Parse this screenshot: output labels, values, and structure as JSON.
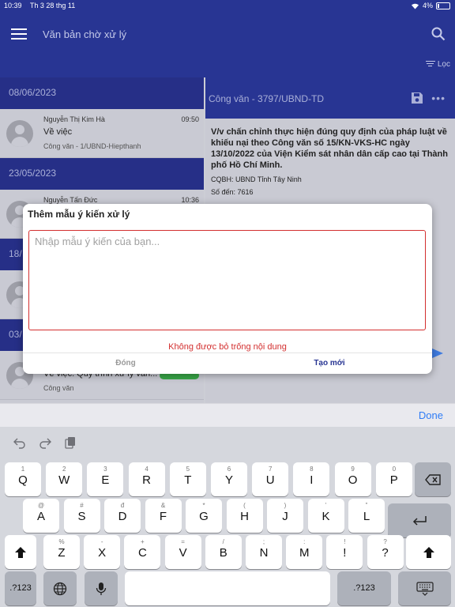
{
  "status_bar": {
    "time": "10:39",
    "date": "Th 3 28 thg 11",
    "battery": "4%"
  },
  "app_bar": {
    "title": "Văn bản chờ xử lý",
    "filter_label": "Lọc"
  },
  "list": {
    "groups": [
      {
        "date": "08/06/2023",
        "sender": "Nguyễn Thị Kim  Hà",
        "time": "09:50",
        "subject": "Về việc",
        "meta": "Công văn - 1/UBND-Hiepthanh"
      },
      {
        "date": "23/05/2023",
        "sender": "Nguyễn Tấn  Đức",
        "time": "10:36",
        "subject": "",
        "meta": ""
      },
      {
        "date": "18/",
        "sender": "",
        "time": "",
        "subject": "",
        "meta": ""
      },
      {
        "date": "03/",
        "sender": "",
        "time": "",
        "subject": "Về việc. Quy trình xử lý  văn...",
        "meta": "Công văn"
      }
    ]
  },
  "detail": {
    "title": "Công văn - 3797/UBND-TD",
    "summary": "V/v chấn chỉnh thực hiện đúng quy định của pháp luật về khiếu nại theo Công văn số 15/KN-VKS-HC ngày 13/10/2022 của Viện Kiểm sát nhân dân cấp cao tại Thành phố Hồ Chí Minh.",
    "cqbh": "CQBH: UBND Tỉnh Tây Ninh",
    "so_den": "Số đến: 7616"
  },
  "dialog": {
    "title": "Thêm mẫu ý kiến xử lý",
    "placeholder": "Nhập mẫu ý kiến của bạn...",
    "error": "Không được bỏ trống nội dung",
    "close_label": "Đóng",
    "create_label": "Tạo mới"
  },
  "keyboard": {
    "done_label": "Done",
    "row1": [
      {
        "sub": "1",
        "main": "Q"
      },
      {
        "sub": "2",
        "main": "W"
      },
      {
        "sub": "3",
        "main": "E"
      },
      {
        "sub": "4",
        "main": "R"
      },
      {
        "sub": "5",
        "main": "T"
      },
      {
        "sub": "6",
        "main": "Y"
      },
      {
        "sub": "7",
        "main": "U"
      },
      {
        "sub": "8",
        "main": "I"
      },
      {
        "sub": "9",
        "main": "O"
      },
      {
        "sub": "0",
        "main": "P"
      }
    ],
    "row2": [
      {
        "sub": "@",
        "main": "A"
      },
      {
        "sub": "#",
        "main": "S"
      },
      {
        "sub": "đ",
        "main": "D"
      },
      {
        "sub": "&",
        "main": "F"
      },
      {
        "sub": "*",
        "main": "G"
      },
      {
        "sub": "(",
        "main": "H"
      },
      {
        "sub": ")",
        "main": "J"
      },
      {
        "sub": "’",
        "main": "K"
      },
      {
        "sub": "”",
        "main": "L"
      }
    ],
    "row3": [
      {
        "sub": "%",
        "main": "Z"
      },
      {
        "sub": "-",
        "main": "X"
      },
      {
        "sub": "+",
        "main": "C"
      },
      {
        "sub": "=",
        "main": "V"
      },
      {
        "sub": "/",
        "main": "B"
      },
      {
        "sub": ";",
        "main": "N"
      },
      {
        "sub": ":",
        "main": "M"
      },
      {
        "sub": "!",
        "main": "!"
      },
      {
        "sub": "?",
        "main": "?"
      }
    ],
    "numbers_label": ".?123"
  },
  "colors": {
    "primary": "#283593",
    "error": "#d32f2f",
    "link": "#2f7cf6"
  },
  "icons": [
    "menu-icon",
    "search-icon",
    "filter-icon",
    "save-icon",
    "more-icon",
    "send-icon",
    "undo-icon",
    "redo-icon",
    "clipboard-icon",
    "backspace-icon",
    "return-icon",
    "shift-icon",
    "globe-icon",
    "microphone-icon",
    "keyboard-dismiss-icon"
  ]
}
